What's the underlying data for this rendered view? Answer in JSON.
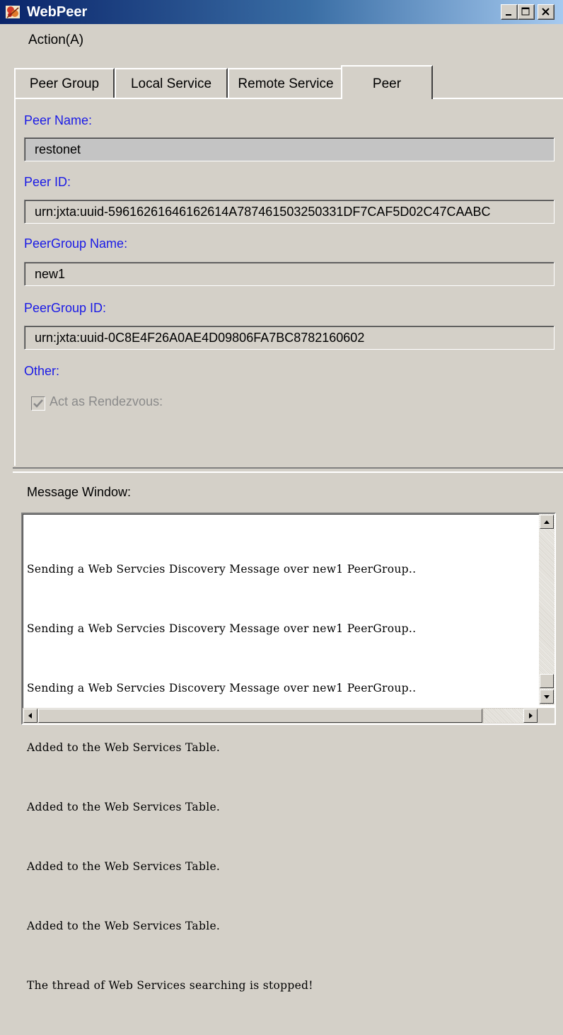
{
  "window": {
    "title": "WebPeer",
    "icon": "app-icon"
  },
  "menu": {
    "action_label": "Action(A)"
  },
  "tabs": [
    {
      "label": "Peer Group",
      "selected": false
    },
    {
      "label": "Local Service",
      "selected": false
    },
    {
      "label": "Remote Service",
      "selected": false
    },
    {
      "label": "Peer",
      "selected": true
    }
  ],
  "peer": {
    "name_label": "Peer Name:",
    "name_value": "restonet",
    "id_label": "Peer ID:",
    "id_value": "urn:jxta:uuid-59616261646162614A787461503250331DF7CAF5D02C47CAABC",
    "group_name_label": "PeerGroup Name:",
    "group_name_value": "new1",
    "group_id_label": "PeerGroup ID:",
    "group_id_value": "urn:jxta:uuid-0C8E4F26A0AE4D09806FA7BC8782160602",
    "other_label": "Other:",
    "rendezvous_label": "Act as Rendezvous:",
    "rendezvous_checked": true
  },
  "message_window": {
    "label": "Message Window:",
    "lines": [
      "Sending a Web Servcies Discovery Message over new1 PeerGroup..",
      "Sending a Web Servcies Discovery Message over new1 PeerGroup..",
      "Sending a Web Servcies Discovery Message over new1 PeerGroup..",
      "Added to the Web Services Table.",
      "Added to the Web Services Table.",
      "Added to the Web Services Table.",
      "Added to the Web Services Table.",
      "The thread of Web Services searching is stopped!"
    ]
  },
  "colors": {
    "label_blue": "#1a1ae6",
    "window_bg": "#d4d0c8",
    "title_start": "#0a246a",
    "title_end": "#a6caf0"
  }
}
